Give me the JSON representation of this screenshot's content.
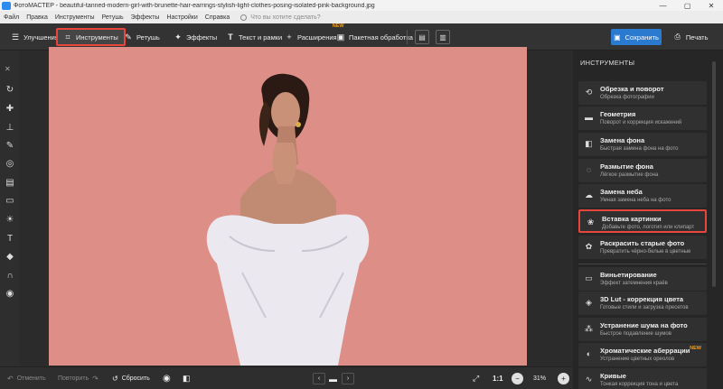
{
  "window": {
    "title": "ФотоМАСТЕР - beautiful-tanned-modern-girl-with-brunette-hair-earrings-stylish-light-clothes-posing-isolated-pink-background.jpg",
    "buttons": [
      "—",
      "▢",
      "✕"
    ]
  },
  "menu": {
    "items": [
      "Файл",
      "Правка",
      "Инструменты",
      "Ретушь",
      "Эффекты",
      "Настройки",
      "Справка"
    ],
    "search_placeholder": "Что вы хотите сделать?"
  },
  "toolbar": {
    "improvements": "Улучшения",
    "tools": "Инструменты",
    "retouch": "Ретушь",
    "effects": "Эффекты",
    "text_frames": "Текст и рамки",
    "extensions": "Расширения",
    "extensions_badge": "NEW",
    "batch": "Пакетная обработка",
    "save": "Сохранить",
    "print": "Печать"
  },
  "panel": {
    "title": "ИНСТРУМЕНТЫ",
    "items": [
      {
        "title": "Обрезка и поворот",
        "subtitle": "Обрезка фотографии",
        "icon": "crop-rotate-icon"
      },
      {
        "title": "Геометрия",
        "subtitle": "Поворот и коррекция искажений",
        "icon": "geometry-icon"
      },
      {
        "title": "Замена фона",
        "subtitle": "Быстрая замена фона на фото",
        "icon": "background-replace-icon"
      },
      {
        "title": "Размытие фона",
        "subtitle": "Лёгкое размытие фона",
        "icon": "blur-icon"
      },
      {
        "title": "Замена неба",
        "subtitle": "Умная замена неба на фото",
        "icon": "sky-icon"
      },
      {
        "title": "Вставка картинки",
        "subtitle": "Добавьте фото, логотип или клипарт",
        "icon": "insert-image-icon"
      },
      {
        "title": "Раскрасить старые фото",
        "subtitle": "Превратить чёрно-белые в цветные",
        "icon": "colorize-icon"
      },
      {
        "title": "Виньетирование",
        "subtitle": "Эффект затемнения краёв",
        "icon": "vignette-icon"
      },
      {
        "title": "3D Lut - коррекция цвета",
        "subtitle": "Готовые стили и загрузка пресетов",
        "icon": "lut-icon"
      },
      {
        "title": "Устранение шума на фото",
        "subtitle": "Быстрое подавление шумов",
        "icon": "noise-icon"
      },
      {
        "title": "Хроматические аберрации",
        "subtitle": "Устранение цветных ореолов",
        "icon": "chromatic-icon",
        "badge": "NEW"
      },
      {
        "title": "Кривые",
        "subtitle": "Тонкая коррекция тона и цвета",
        "icon": "curves-icon"
      }
    ]
  },
  "bottom": {
    "undo": "Отменить",
    "redo": "Повторить",
    "reset": "Сбросить",
    "zoom_1_1": "1:1",
    "zoom_value": "31%"
  },
  "colors": {
    "accent": "#2a7ad0",
    "highlight": "#e8453c",
    "photo_background": "#dd8e86"
  }
}
